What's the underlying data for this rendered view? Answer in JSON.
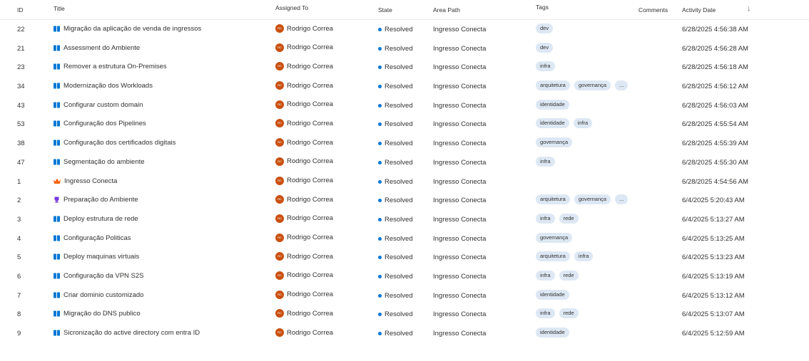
{
  "columns": {
    "id": "ID",
    "title": "Title",
    "assigned_to": "Assigned To",
    "state": "State",
    "area_path": "Area Path",
    "tags": "Tags",
    "comments": "Comments",
    "activity_date": "Activity Date",
    "sort_indicator": "↓"
  },
  "colors": {
    "book_icon": "#0078d4",
    "crown_icon": "#f7630c",
    "trophy_icon": "#773adc",
    "resolved_dot": "#0078d4",
    "avatar": "#ca5010",
    "tag_bg": "#dde8f4"
  },
  "rows": [
    {
      "id": "22",
      "type": "book",
      "title": "Migração da aplicação de venda de ingressos",
      "avatar": "RC",
      "assigned": "Rodrigo Correa",
      "state": "Resolved",
      "area": "Ingresso Conecta",
      "tags": [
        "dev"
      ],
      "date": "6/28/2025 4:56:38 AM"
    },
    {
      "id": "21",
      "type": "book",
      "title": "Assessment do Ambiente",
      "avatar": "RC",
      "assigned": "Rodrigo Correa",
      "state": "Resolved",
      "area": "Ingresso Conecta",
      "tags": [
        "dev"
      ],
      "date": "6/28/2025 4:56:28 AM"
    },
    {
      "id": "23",
      "type": "book",
      "title": "Remover a estrutura On-Premises",
      "avatar": "RC",
      "assigned": "Rodrigo Correa",
      "state": "Resolved",
      "area": "Ingresso Conecta",
      "tags": [
        "infra"
      ],
      "date": "6/28/2025 4:56:18 AM"
    },
    {
      "id": "34",
      "type": "book",
      "title": "Modernização dos Workloads",
      "avatar": "RC",
      "assigned": "Rodrigo Correa",
      "state": "Resolved",
      "area": "Ingresso Conecta",
      "tags": [
        "arquitetura",
        "governança",
        "..."
      ],
      "date": "6/28/2025 4:56:12 AM"
    },
    {
      "id": "43",
      "type": "book",
      "title": "Configurar custom domain",
      "avatar": "RC",
      "assigned": "Rodrigo Correa",
      "state": "Resolved",
      "area": "Ingresso Conecta",
      "tags": [
        "identidade"
      ],
      "date": "6/28/2025 4:56:03 AM"
    },
    {
      "id": "53",
      "type": "book",
      "title": "Configuração dos Pipelines",
      "avatar": "RC",
      "assigned": "Rodrigo Correa",
      "state": "Resolved",
      "area": "Ingresso Conecta",
      "tags": [
        "identidade",
        "infra"
      ],
      "date": "6/28/2025 4:55:54 AM"
    },
    {
      "id": "38",
      "type": "book",
      "title": "Configuração dos certificados digitais",
      "avatar": "RC",
      "assigned": "Rodrigo Correa",
      "state": "Resolved",
      "area": "Ingresso Conecta",
      "tags": [
        "governança"
      ],
      "date": "6/28/2025 4:55:39 AM"
    },
    {
      "id": "47",
      "type": "book",
      "title": "Segmentação do ambiente",
      "avatar": "RC",
      "assigned": "Rodrigo Correa",
      "state": "Resolved",
      "area": "Ingresso Conecta",
      "tags": [
        "infra"
      ],
      "date": "6/28/2025 4:55:30 AM"
    },
    {
      "id": "1",
      "type": "crown",
      "title": "Ingresso Conecta",
      "avatar": "RC",
      "assigned": "Rodrigo Correa",
      "state": "Resolved",
      "area": "Ingresso Conecta",
      "tags": [],
      "date": "6/28/2025 4:54:56 AM"
    },
    {
      "id": "2",
      "type": "trophy",
      "title": "Preparação do Ambiente",
      "avatar": "RC",
      "assigned": "Rodrigo Correa",
      "state": "Resolved",
      "area": "Ingresso Conecta",
      "tags": [
        "arquitetura",
        "governança",
        "..."
      ],
      "date": "6/4/2025 5:20:43 AM"
    },
    {
      "id": "3",
      "type": "book",
      "title": "Deploy estrutura de rede",
      "avatar": "RC",
      "assigned": "Rodrigo Correa",
      "state": "Resolved",
      "area": "Ingresso Conecta",
      "tags": [
        "infra",
        "rede"
      ],
      "date": "6/4/2025 5:13:27 AM"
    },
    {
      "id": "4",
      "type": "book",
      "title": "Configuração Politicas",
      "avatar": "RC",
      "assigned": "Rodrigo Correa",
      "state": "Resolved",
      "area": "Ingresso Conecta",
      "tags": [
        "governança"
      ],
      "date": "6/4/2025 5:13:25 AM"
    },
    {
      "id": "5",
      "type": "book",
      "title": "Deploy maquinas virtuais",
      "avatar": "RC",
      "assigned": "Rodrigo Correa",
      "state": "Resolved",
      "area": "Ingresso Conecta",
      "tags": [
        "arquitetura",
        "infra"
      ],
      "date": "6/4/2025 5:13:23 AM"
    },
    {
      "id": "6",
      "type": "book",
      "title": "Configuração da VPN S2S",
      "avatar": "RC",
      "assigned": "Rodrigo Correa",
      "state": "Resolved",
      "area": "Ingresso Conecta",
      "tags": [
        "infra",
        "rede"
      ],
      "date": "6/4/2025 5:13:19 AM"
    },
    {
      "id": "7",
      "type": "book",
      "title": "Criar dominio customizado",
      "avatar": "RC",
      "assigned": "Rodrigo Correa",
      "state": "Resolved",
      "area": "Ingresso Conecta",
      "tags": [
        "identidade"
      ],
      "date": "6/4/2025 5:13:12 AM"
    },
    {
      "id": "8",
      "type": "book",
      "title": "Migração do DNS publico",
      "avatar": "RC",
      "assigned": "Rodrigo Correa",
      "state": "Resolved",
      "area": "Ingresso Conecta",
      "tags": [
        "infra",
        "rede"
      ],
      "date": "6/4/2025 5:13:07 AM"
    },
    {
      "id": "9",
      "type": "book",
      "title": "Sicronização do active directory com entra ID",
      "avatar": "RC",
      "assigned": "Rodrigo Correa",
      "state": "Resolved",
      "area": "Ingresso Conecta",
      "tags": [
        "identidade"
      ],
      "date": "6/4/2025 5:12:59 AM"
    }
  ]
}
